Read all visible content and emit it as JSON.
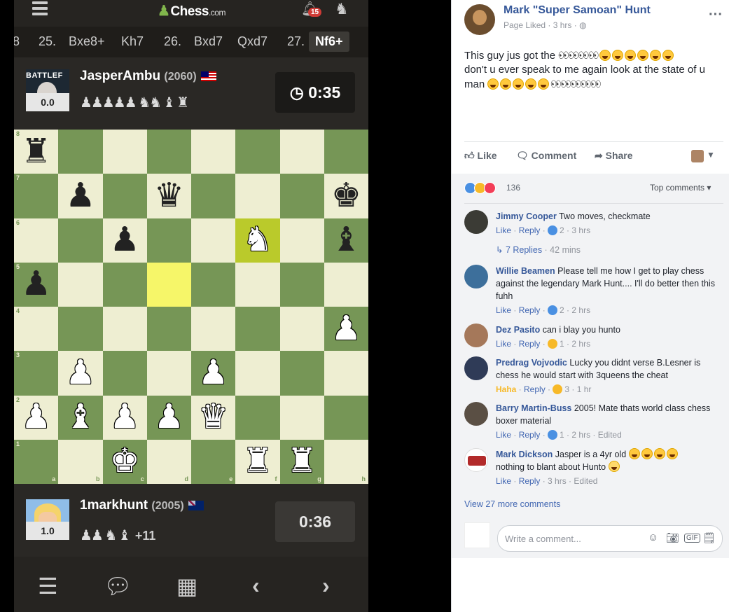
{
  "phone": {
    "logo_text": "Chess",
    "logo_suffix": ".com",
    "notif_count": "15",
    "moves": [
      "8",
      "25.",
      "Bxe8+",
      "Kh7",
      "26.",
      "Bxd7",
      "Qxd7",
      "27.",
      "Nf6+"
    ],
    "top_player": {
      "avatar_text": "BATTLEF",
      "score": "0.0",
      "name": "JasperAmbu",
      "rating": "(2060)",
      "captured": "♟♟♟♟♟ ♞♞ ♝ ♜",
      "clock": "◷ 0:35"
    },
    "bottom_player": {
      "score": "1.0",
      "name": "1markhunt",
      "rating": "(2005)",
      "captured": "♟♟ ♞ ♝",
      "advantage": "+11",
      "clock": "0:36"
    },
    "ranks": [
      "8",
      "7",
      "6",
      "5",
      "4",
      "3",
      "2",
      "1"
    ],
    "files": [
      "a",
      "b",
      "c",
      "d",
      "e",
      "f",
      "g",
      "h"
    ],
    "board": [
      [
        "bR",
        "",
        "",
        "",
        "",
        "",
        "",
        ""
      ],
      [
        "",
        "bP",
        "",
        "bQ",
        "",
        "",
        "",
        "bK"
      ],
      [
        "",
        "",
        "bP",
        "",
        "",
        "wN",
        "",
        "bB"
      ],
      [
        "bP",
        "",
        "",
        "",
        "",
        "",
        "",
        ""
      ],
      [
        "",
        "",
        "",
        "",
        "",
        "",
        "",
        "wP"
      ],
      [
        "",
        "wP",
        "",
        "",
        "wP",
        "",
        "",
        ""
      ],
      [
        "wP",
        "wB",
        "wP",
        "wP",
        "wQ",
        "",
        "",
        ""
      ],
      [
        "",
        "",
        "wK",
        "",
        "",
        "wR",
        "wR",
        ""
      ]
    ],
    "highlights": [
      "d5",
      "f6"
    ],
    "nav_icons": [
      "list-icon",
      "chat-icon",
      "analysis-icon",
      "prev-icon",
      "next-icon"
    ]
  },
  "fb": {
    "page_name": "Mark \"Super Samoan\" Hunt",
    "meta": "Page Liked · 3 hrs · ",
    "post_line1": "This guy jus got the",
    "post_line2": "don't u ever speak to me again look at the state of u",
    "post_line3": "man",
    "like": "Like",
    "comment": "Comment",
    "share": "Share",
    "reaction_count": "136",
    "top_comments": "Top comments ▾",
    "comments": [
      {
        "name": "Jimmy Cooper",
        "text": "Two moves, checkmate",
        "meta": "2 · 3 hrs",
        "react": "like",
        "avatar": "#3b3b35"
      },
      {
        "name": "Willie Beamen",
        "text": "Please tell me how I get to play chess against the legendary Mark Hunt.... I'll do better then this fuhh",
        "meta": "2 · 2 hrs",
        "react": "like",
        "avatar": "#3d6f9b"
      },
      {
        "name": "Dez Pasito",
        "text": "can i blay you hunto",
        "meta": "1 · 2 hrs",
        "react": "wow",
        "avatar": "#a5785a"
      },
      {
        "name": "Predrag Vojvodic",
        "text": "Lucky you didnt verse B.Lesner is chess he would start with 3queens the cheat",
        "meta": "3 · 1 hr",
        "react": "haha",
        "avatar": "#2f3b57"
      },
      {
        "name": "Barry Martin-Buss",
        "text": "2005! Mate thats world class chess boxer material",
        "meta": "1 · 2 hrs · Edited",
        "react": "like",
        "avatar": "#5a4f44"
      },
      {
        "name": "Mark Dickson",
        "text": "Jasper is a 4yr old",
        "text2": "nothing to blant about Hunto",
        "meta": "3 hrs · Edited",
        "react": "",
        "avatar": "#b22a2a"
      }
    ],
    "like_label": "Like",
    "haha_label": "Haha",
    "reply_label": "Reply",
    "replies_text": "7 Replies",
    "replies_time": " · 42 mins",
    "view_more": "View 27 more comments",
    "write_placeholder": "Write a comment..."
  }
}
